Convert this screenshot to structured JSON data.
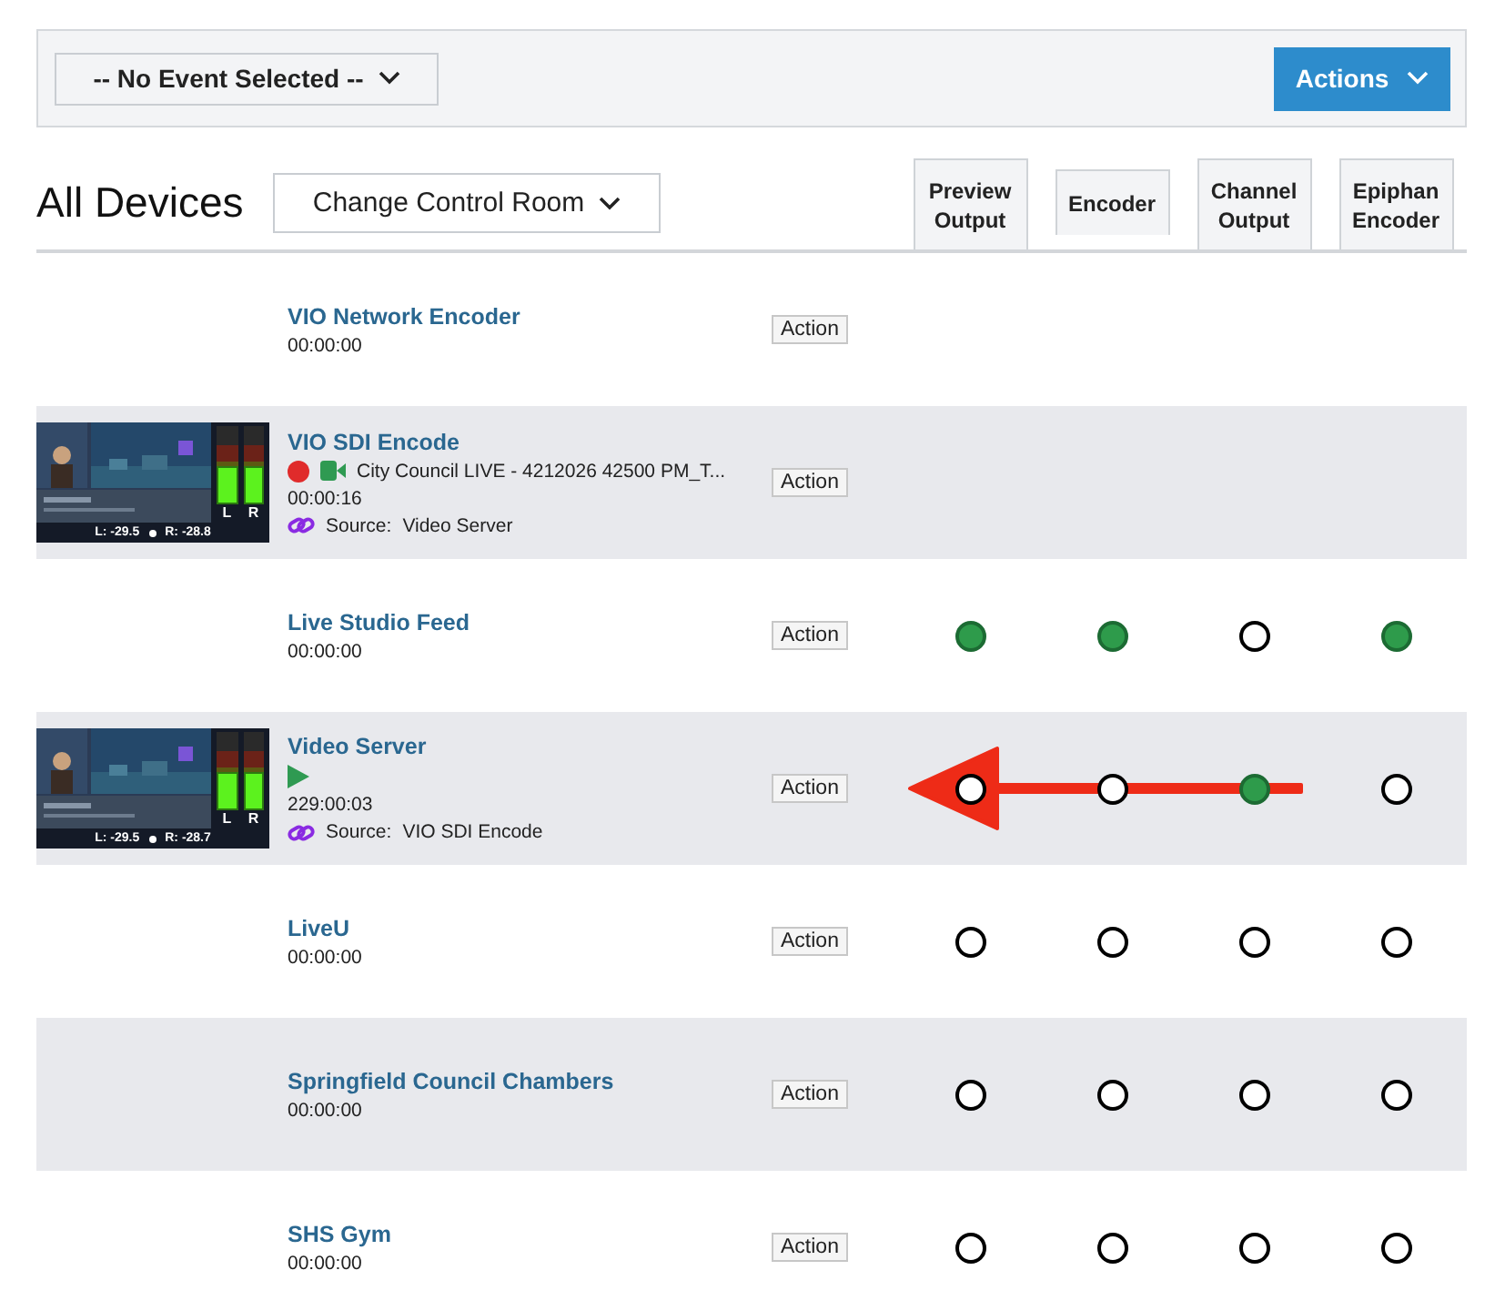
{
  "toolbar": {
    "event_dropdown": "-- No Event Selected --",
    "actions_button": "Actions"
  },
  "heading": "All Devices",
  "control_room_button": "Change Control Room",
  "columns": [
    "Preview Output",
    "Encoder",
    "Channel Output",
    "Epiphan Encoder"
  ],
  "devices": [
    {
      "name": "VIO Network Encoder",
      "time": "00:00:00",
      "action": "Action"
    },
    {
      "name": "VIO SDI Encode",
      "time": "00:00:16",
      "action": "Action",
      "thumbnail": {
        "meters": [
          {
            "label": "L",
            "level": 0.45
          },
          {
            "label": "R",
            "level": 0.45
          }
        ],
        "left_reading": "L: -29.5",
        "right_reading": "R: -28.8"
      },
      "indicators": [
        {
          "kind": "record"
        },
        {
          "kind": "camera"
        }
      ],
      "title": "City Council LIVE - 4212026 42500 PM_T...",
      "source_label": "Source:",
      "source": "Video Server"
    },
    {
      "name": "Live Studio Feed",
      "time": "00:00:00",
      "action": "Action",
      "outputs": [
        {
          "on": true
        },
        {
          "on": true
        },
        {
          "on": false
        },
        {
          "on": true
        }
      ]
    },
    {
      "name": "Video Server",
      "time": "229:00:03",
      "action": "Action",
      "thumbnail": {
        "meters": [
          {
            "label": "L",
            "level": 0.45
          },
          {
            "label": "R",
            "level": 0.45
          }
        ],
        "left_reading": "L: -29.5",
        "right_reading": "R: -28.7"
      },
      "indicators": [
        {
          "kind": "play"
        }
      ],
      "source_label": "Source:",
      "source": "VIO SDI Encode",
      "outputs": [
        {
          "on": false
        },
        {
          "on": false
        },
        {
          "on": true
        },
        {
          "on": false
        }
      ],
      "arrow": true
    },
    {
      "name": "LiveU",
      "time": "00:00:00",
      "action": "Action",
      "outputs": [
        {
          "on": false
        },
        {
          "on": false
        },
        {
          "on": false
        },
        {
          "on": false
        }
      ]
    },
    {
      "name": "Springfield Council Chambers",
      "time": "00:00:00",
      "action": "Action",
      "outputs": [
        {
          "on": false
        },
        {
          "on": false
        },
        {
          "on": false
        },
        {
          "on": false
        }
      ]
    },
    {
      "name": "SHS Gym",
      "time": "00:00:00",
      "action": "Action",
      "outputs": [
        {
          "on": false
        },
        {
          "on": false
        },
        {
          "on": false
        },
        {
          "on": false
        }
      ]
    }
  ]
}
